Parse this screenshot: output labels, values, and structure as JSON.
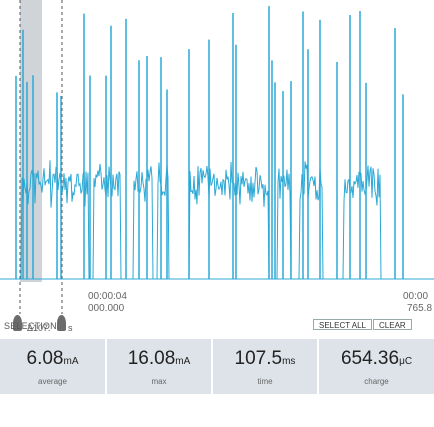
{
  "cursor_left": {
    "time": "00:00:04",
    "sub": "000.000"
  },
  "cursor_right": {
    "time": "00:00",
    "sub": "765.8"
  },
  "delta": {
    "label": "Δ107.",
    "suffix": "s"
  },
  "selection": {
    "label": "SELECTION",
    "select_all": "SELECT ALL",
    "clear": "CLEAR"
  },
  "stats": {
    "average": {
      "value": "6.08",
      "unit": "mA",
      "label": "average"
    },
    "max": {
      "value": "16.08",
      "unit": "mA",
      "label": "max"
    },
    "time": {
      "value": "107.5",
      "unit": "ms",
      "label": "time"
    },
    "charge": {
      "value": "654.36",
      "unit": "μC",
      "label": "charge"
    }
  },
  "colors": {
    "trace": "#2ba8d6",
    "selection_shade": "#cfd4d9",
    "stat_bg": "#dde3e9"
  }
}
